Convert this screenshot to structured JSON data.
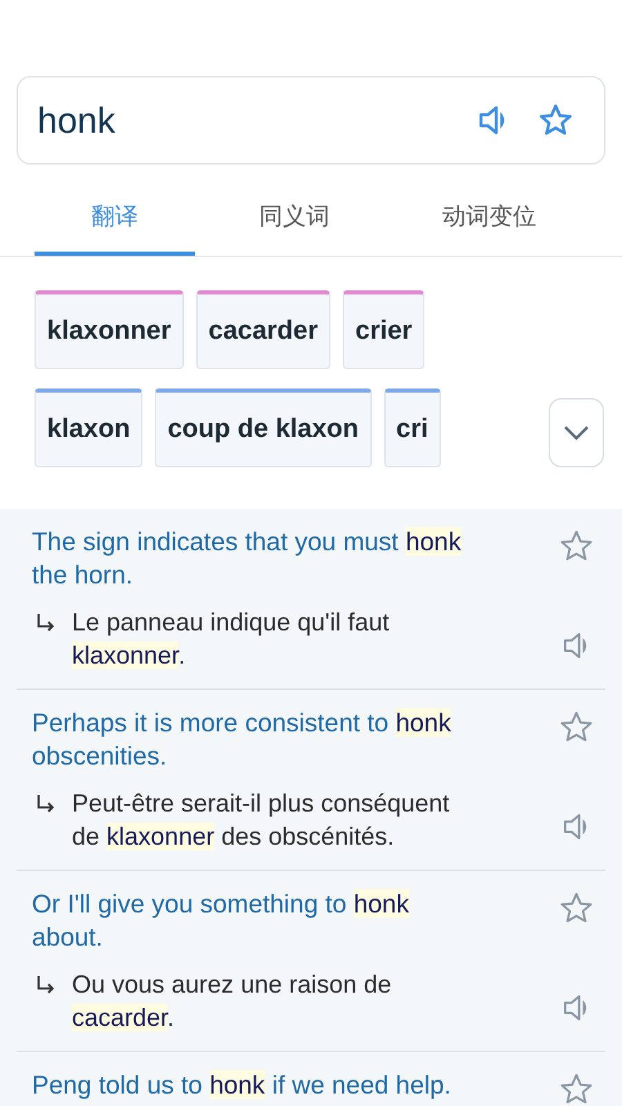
{
  "search": {
    "value": "honk"
  },
  "tabs": [
    {
      "label": "翻译",
      "selected": true
    },
    {
      "label": "同义词",
      "selected": false
    },
    {
      "label": "动词变位",
      "selected": false
    }
  ],
  "chip_rows": [
    {
      "chips": [
        {
          "label": "klaxonner",
          "color": "#e08ad0"
        },
        {
          "label": "cacarder",
          "color": "#e08ad0"
        },
        {
          "label": "crier",
          "color": "#e08ad0"
        }
      ]
    },
    {
      "chips": [
        {
          "label": "klaxon",
          "color": "#7ea8e6"
        },
        {
          "label": "coup de klaxon",
          "color": "#7ea8e6"
        },
        {
          "label": "cri",
          "color": "#7ea8e6"
        }
      ]
    }
  ],
  "examples": [
    {
      "source": [
        {
          "text": "The sign indicates that you must "
        },
        {
          "text": "honk",
          "highlight": true
        },
        {
          "text": " the horn."
        }
      ],
      "translation": [
        {
          "text": "Le panneau indique qu'il faut "
        },
        {
          "text": "klaxonner",
          "highlight": true
        },
        {
          "text": "."
        }
      ]
    },
    {
      "source": [
        {
          "text": "Perhaps it is more consistent to "
        },
        {
          "text": "honk",
          "highlight": true
        },
        {
          "text": " obscenities."
        }
      ],
      "translation": [
        {
          "text": "Peut-être serait-il plus conséquent de "
        },
        {
          "text": "klaxonner",
          "highlight": true
        },
        {
          "text": " des obscénités."
        }
      ]
    },
    {
      "source": [
        {
          "text": "Or I'll give you something to "
        },
        {
          "text": "honk",
          "highlight": true
        },
        {
          "text": " about."
        }
      ],
      "translation": [
        {
          "text": "Ou vous aurez une raison de "
        },
        {
          "text": "cacarder",
          "highlight": true
        },
        {
          "text": "."
        }
      ]
    },
    {
      "source": [
        {
          "text": "Peng told us to "
        },
        {
          "text": "honk",
          "highlight": true
        },
        {
          "text": " if we need help."
        }
      ]
    }
  ]
}
